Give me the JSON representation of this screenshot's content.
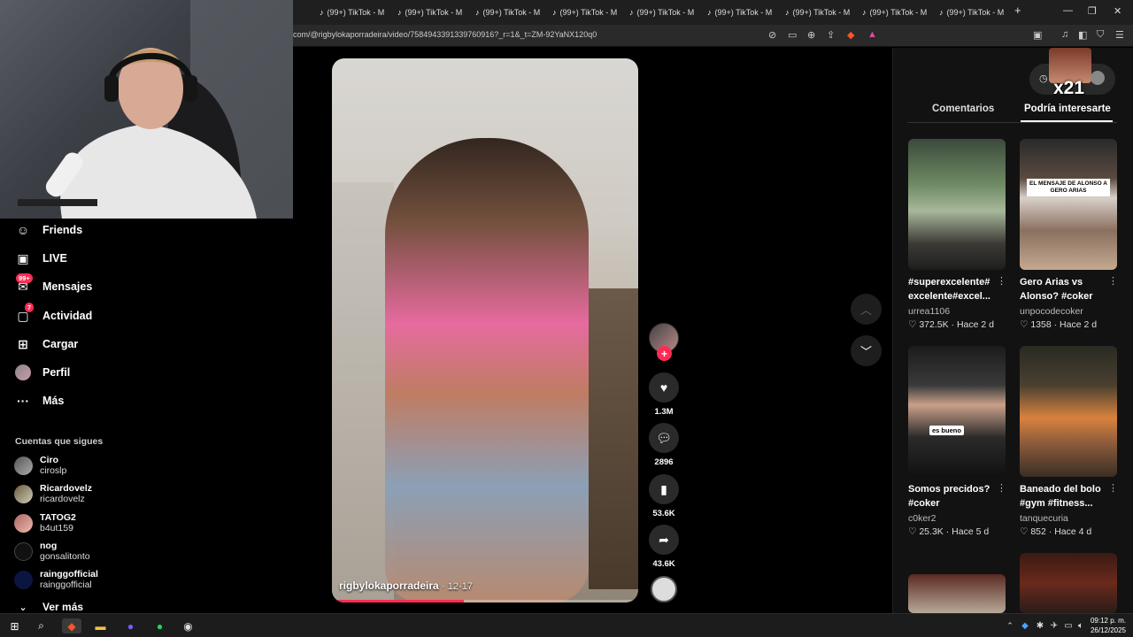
{
  "browser": {
    "tabs": [
      "(99+) TikTok - M",
      "(99+) TikTok - M",
      "(99+) TikTok - M",
      "(99+) TikTok - M",
      "(99+) TikTok - M",
      "(99+) TikTok - M",
      "(99+) TikTok - M",
      "(99+) TikTok - M",
      "(99+) TikTok - M"
    ],
    "url": "com/@rigbylokaporradeira/video/7584943391339760916?_r=1&_t=ZM-92YaNX120q0",
    "new_tab": "+"
  },
  "sidebar": {
    "items": [
      {
        "label": "Friends",
        "icon": "friends-icon",
        "glyph": "☺"
      },
      {
        "label": "LIVE",
        "icon": "live-icon",
        "glyph": "▣"
      },
      {
        "label": "Mensajes",
        "icon": "messages-icon",
        "glyph": "✉",
        "badge": "99+"
      },
      {
        "label": "Actividad",
        "icon": "activity-icon",
        "glyph": "▢",
        "badge": "7"
      },
      {
        "label": "Cargar",
        "icon": "upload-icon",
        "glyph": "⊞"
      },
      {
        "label": "Perfil",
        "icon": "profile-icon",
        "glyph": "●"
      },
      {
        "label": "Más",
        "icon": "more-icon",
        "glyph": "···"
      }
    ],
    "following_title": "Cuentas que sigues",
    "following": [
      {
        "name": "Ciro",
        "handle": "ciroslp"
      },
      {
        "name": "Ricardovelz",
        "handle": "ricardovelz"
      },
      {
        "name": "TATOG2",
        "handle": "b4ut159"
      },
      {
        "name": "nog",
        "handle": "gonsalitonto"
      },
      {
        "name": "rainggofficial",
        "handle": "rainggofficial"
      }
    ],
    "see_more": "Ver más"
  },
  "video": {
    "author": "rigbylokaporradeira",
    "date": "12-17",
    "progress": 0.43
  },
  "actions": {
    "likes": "1.3M",
    "comments": "2896",
    "saves": "53.6K",
    "shares": "43.6K"
  },
  "panel": {
    "overlay_text": "x21",
    "tabs": [
      "Comentarios",
      "Podría interesarte"
    ],
    "active_tab": 1,
    "cards": [
      {
        "title": "#superexcelente# excelente#excel...",
        "user": "urrea1106",
        "likes": "372.5K",
        "age": "Hace 2 d"
      },
      {
        "title": "Gero Arias vs Alonso? #coker",
        "user": "unpocodecoker",
        "likes": "1358",
        "age": "Hace 2 d",
        "thumb_text": "EL MENSAJE DE ALONSO A GERO ARIAS"
      },
      {
        "title": "Somos precidos? #coker",
        "user": "c0ker2",
        "likes": "25.3K",
        "age": "Hace 5 d",
        "thumb_text": "es bueno"
      },
      {
        "title": "Baneado del bolo #gym #fitness...",
        "user": "tanquecuria",
        "likes": "852",
        "age": "Hace 4 d"
      }
    ]
  },
  "taskbar": {
    "time": "09:12 p. m.",
    "date": "26/12/2025"
  }
}
